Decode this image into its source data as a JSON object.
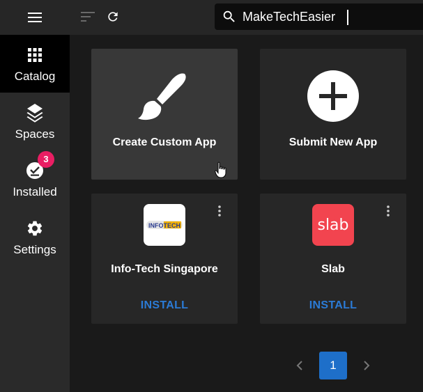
{
  "sidebar": {
    "items": [
      {
        "label": "Catalog",
        "icon": "grid-icon",
        "active": true
      },
      {
        "label": "Spaces",
        "icon": "layers-icon"
      },
      {
        "label": "Installed",
        "icon": "installed-icon",
        "badge": "3"
      },
      {
        "label": "Settings",
        "icon": "gear-icon"
      }
    ]
  },
  "search": {
    "value": "MakeTechEasier"
  },
  "cards": [
    {
      "title": "Create Custom App",
      "icon": "paintbrush-icon"
    },
    {
      "title": "Submit New App",
      "icon": "plus-circle-icon"
    },
    {
      "title": "Info-Tech Singapore",
      "action": "INSTALL",
      "logo_text": "INFOTECH"
    },
    {
      "title": "Slab",
      "action": "INSTALL",
      "logo_text": "slab"
    }
  ],
  "pagination": {
    "current": "1"
  },
  "colors": {
    "accent": "#1e6fc9",
    "install_text": "#2b7bd6",
    "badge": "#e91e63",
    "slab_logo": "#f2444f"
  }
}
